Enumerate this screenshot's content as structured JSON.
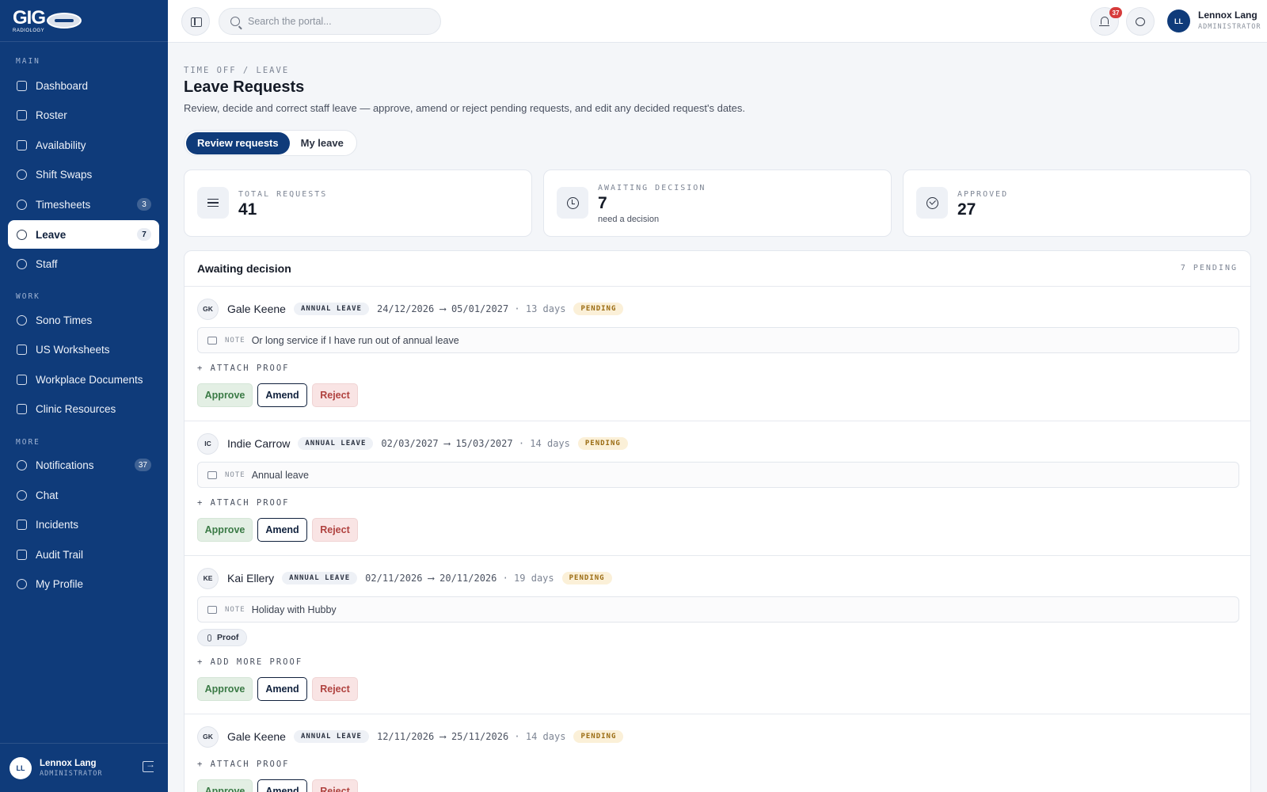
{
  "brand": {
    "name": "GIG",
    "sub": "RADIOLOGY"
  },
  "sidebar": {
    "sections": [
      {
        "label": "MAIN"
      },
      {
        "label": "WORK"
      },
      {
        "label": "MORE"
      }
    ],
    "items": [
      {
        "label": "Dashboard",
        "icon": "grid-icon"
      },
      {
        "label": "Roster",
        "icon": "calendar-icon"
      },
      {
        "label": "Availability",
        "icon": "calendar-check-icon"
      },
      {
        "label": "Shift Swaps",
        "icon": "swap-icon"
      },
      {
        "label": "Timesheets",
        "icon": "clock-icon",
        "badge": "3"
      },
      {
        "label": "Leave",
        "icon": "palm-icon",
        "badge": "7",
        "active": true
      },
      {
        "label": "Staff",
        "icon": "users-icon"
      },
      {
        "label": "Sono Times",
        "icon": "clock-icon"
      },
      {
        "label": "US Worksheets",
        "icon": "document-icon"
      },
      {
        "label": "Workplace Documents",
        "icon": "folder-icon"
      },
      {
        "label": "Clinic Resources",
        "icon": "book-icon"
      },
      {
        "label": "Notifications",
        "icon": "bell-icon",
        "badge": "37"
      },
      {
        "label": "Chat",
        "icon": "chat-icon"
      },
      {
        "label": "Incidents",
        "icon": "warning-icon"
      },
      {
        "label": "Audit Trail",
        "icon": "shield-icon"
      },
      {
        "label": "My Profile",
        "icon": "user-icon"
      }
    ],
    "user": {
      "initials": "LL",
      "name": "Lennox Lang",
      "role": "ADMINISTRATOR"
    }
  },
  "topbar": {
    "search_placeholder": "Search the portal...",
    "notification_count": "37",
    "user": {
      "initials": "LL",
      "name": "Lennox Lang",
      "role": "ADMINISTRATOR"
    }
  },
  "page": {
    "breadcrumb": "TIME OFF / LEAVE",
    "title": "Leave Requests",
    "description": "Review, decide and correct staff leave — approve, amend or reject pending requests, and edit any decided request's dates.",
    "tabs": [
      {
        "label": "Review requests",
        "active": true
      },
      {
        "label": "My leave"
      }
    ]
  },
  "stats": [
    {
      "label": "TOTAL REQUESTS",
      "value": "41",
      "icon": "list-icon"
    },
    {
      "label": "AWAITING DECISION",
      "value": "7",
      "sub": "need a decision",
      "icon": "clock-icon"
    },
    {
      "label": "APPROVED",
      "value": "27",
      "icon": "check-circle-icon"
    }
  ],
  "panel": {
    "title": "Awaiting decision",
    "count": "7 PENDING",
    "requests": [
      {
        "initials": "GK",
        "name": "Gale Keene",
        "type": "ANNUAL LEAVE",
        "start": "24/12/2026",
        "end": "05/01/2027",
        "duration": "· 13 days",
        "status": "PENDING",
        "note_label": "NOTE",
        "note": "Or long service if I have run out of annual leave",
        "attach": "+ ATTACH PROOF"
      },
      {
        "initials": "IC",
        "name": "Indie Carrow",
        "type": "ANNUAL LEAVE",
        "start": "02/03/2027",
        "end": "15/03/2027",
        "duration": "· 14 days",
        "status": "PENDING",
        "note_label": "NOTE",
        "note": "Annual leave",
        "attach": "+ ATTACH PROOF"
      },
      {
        "initials": "KE",
        "name": "Kai Ellery",
        "type": "ANNUAL LEAVE",
        "start": "02/11/2026",
        "end": "20/11/2026",
        "duration": "· 19 days",
        "status": "PENDING",
        "note_label": "NOTE",
        "note": "Holiday with Hubby",
        "proof": "Proof",
        "attach": "+ ADD MORE PROOF"
      },
      {
        "initials": "GK",
        "name": "Gale Keene",
        "type": "ANNUAL LEAVE",
        "start": "12/11/2026",
        "end": "25/11/2026",
        "duration": "· 14 days",
        "status": "PENDING",
        "attach": "+ ATTACH PROOF"
      }
    ],
    "actions": {
      "approve": "Approve",
      "amend": "Amend",
      "reject": "Reject"
    },
    "arrow": "⟶"
  },
  "colors": {
    "sidebar": "#0f3b7a",
    "accent": "#0f3b7a",
    "pending": "#9a6b12",
    "approve": "#3a7a45",
    "reject": "#b0423f",
    "badge": "#d63b3b"
  }
}
